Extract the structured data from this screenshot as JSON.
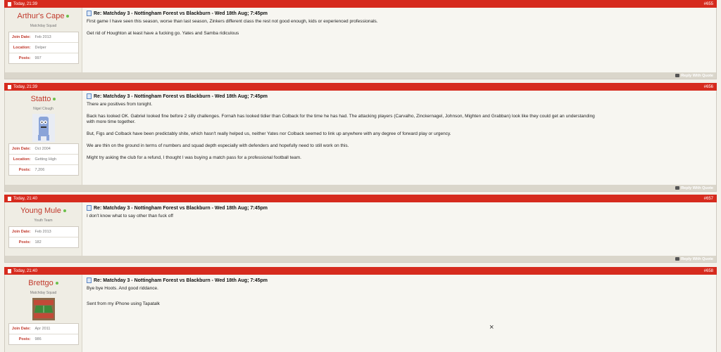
{
  "posts": [
    {
      "timestamp": "Today, 21:39",
      "post_number": "#655",
      "username": "Arthur's Cape",
      "user_title": "Matchday Squad",
      "avatar": "",
      "details": [
        {
          "label": "Join Date:",
          "value": "Feb 2013"
        },
        {
          "label": "Location:",
          "value": "Delper"
        },
        {
          "label": "Posts:",
          "value": "997"
        }
      ],
      "title": "Re: Matchday 3 - Nottingham Forest vs Blackburn - Wed 18th Aug; 7:45pm",
      "paragraphs": [
        "First game I have seen this season, worse than last season, Zinkers different class the rest not good enough, kids or experienced professionals.",
        "Get rid of Houghton at least have a fucking go. Yates and Samba ridiculous"
      ],
      "reply_label": "Reply With Quote"
    },
    {
      "timestamp": "Today, 21:39",
      "post_number": "#656",
      "username": "Statto",
      "user_title": "Nigel Clough",
      "avatar": "towelie",
      "details": [
        {
          "label": "Join Date:",
          "value": "Oct 2004"
        },
        {
          "label": "Location:",
          "value": "Getting High"
        },
        {
          "label": "Posts:",
          "value": "7,206"
        }
      ],
      "title": "Re: Matchday 3 - Nottingham Forest vs Blackburn - Wed 18th Aug; 7:45pm",
      "paragraphs": [
        "There are positives from tonight.",
        "Back has looked OK. Gabriel looked fine before 2 silly challenges. Fornah has looked tidier than Colback for the time he has had. The attacking players (Carvalho, Zinckernagel, Johnson, Mighten and Grabban) look like they could get an understanding with more time together.",
        "But, Figs and Colback have been predictably shite, which hasn't really helped us, neither Yates nor Colback seemed to link up anywhere with any degree of forward play or urgency.",
        "We are thin on the ground in terms of numbers and squad depth especially with defenders and hopefully need to still work on this.",
        "Might try asking the club for a refund, I thought I was buying a match pass for a professional football team."
      ],
      "reply_label": "Reply With Quote"
    },
    {
      "timestamp": "Today, 21:40",
      "post_number": "#657",
      "username": "Young Mule",
      "user_title": "Youth Team",
      "avatar": "",
      "details": [
        {
          "label": "Join Date:",
          "value": "Feb 2013"
        },
        {
          "label": "Posts:",
          "value": "182"
        }
      ],
      "title": "Re: Matchday 3 - Nottingham Forest vs Blackburn - Wed 18th Aug; 7:45pm",
      "paragraphs": [
        "I don't know what to say other than fuck off"
      ],
      "reply_label": "Reply With Quote"
    },
    {
      "timestamp": "Today, 21:40",
      "post_number": "#658",
      "username": "Brettgo",
      "user_title": "Matchday Squad",
      "avatar": "stadium",
      "details": [
        {
          "label": "Join Date:",
          "value": "Apr 2011"
        },
        {
          "label": "Posts:",
          "value": "986"
        }
      ],
      "title": "Re: Matchday 3 - Nottingham Forest vs Blackburn - Wed 18th Aug; 7:45pm",
      "paragraphs": [
        "Bye bye Hoots. And good riddance.",
        "Sent from my iPhone using Tapatalk"
      ],
      "reply_label": ""
    }
  ],
  "close_label": "×"
}
